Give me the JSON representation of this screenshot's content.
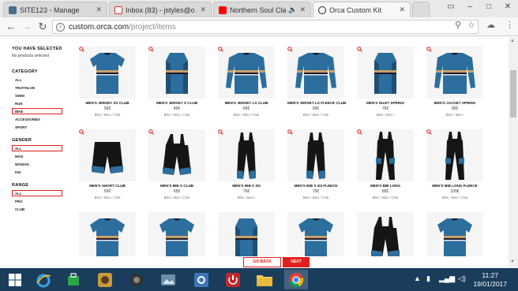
{
  "browser": {
    "tabs": [
      {
        "title": "SITE123 - Manage",
        "icon": "site123-icon",
        "color": "#4a6b8a"
      },
      {
        "title": "Inbox (83) - jstyles@o",
        "icon": "gmail-icon",
        "color": "#d93025"
      },
      {
        "title": "Northern Soul Clas",
        "icon": "youtube-icon",
        "color": "#ff0000"
      },
      {
        "title": "Orca Custom Kit",
        "icon": "orca-icon",
        "color": "#222222"
      }
    ],
    "url_host": "custom.orca.com",
    "url_path": "/project/items"
  },
  "sidebar": {
    "selected_heading": "YOU HAVE SELECTED",
    "selected_note": "No products selected",
    "category_heading": "CATEGORY",
    "categories": [
      "ALL",
      "TRIATHLON",
      "SWIM",
      "RUN",
      "BIKE",
      "ACCESSORIES",
      "SPORT"
    ],
    "category_selected": "BIKE",
    "gender_heading": "GENDER",
    "genders": [
      "ALL",
      "MAN",
      "WOMAN",
      "KID"
    ],
    "gender_selected": "ALL",
    "range_heading": "RANGE",
    "ranges": [
      "ALL",
      "PRO",
      "CLUB"
    ],
    "range_selected": "ALL"
  },
  "products": [
    {
      "name": "MEN'S JERSEY SS CLUB",
      "price": "50€",
      "category": "Bike / Man / Club",
      "kind": "jersey-ss"
    },
    {
      "name": "MEN'S JERSEY S CLUB",
      "price": "45€",
      "category": "Bike / Man / Club",
      "kind": "vest"
    },
    {
      "name": "MEN'S JERSEY LS CLUB",
      "price": "65€",
      "category": "Bike / Man / Club",
      "kind": "jersey-ls"
    },
    {
      "name": "MEN'S JERSEY LS FLEECE CLUB",
      "price": "69€",
      "category": "Bike / Man / Club",
      "kind": "jersey-ls"
    },
    {
      "name": "MEN'S GILET SPRING",
      "price": "75€",
      "category": "Bike / Man /",
      "kind": "vest"
    },
    {
      "name": "MEN'S JACKET SPRING",
      "price": "95€",
      "category": "Bike / Man /",
      "kind": "jersey-ls"
    },
    {
      "name": "MEN'S SHORT CLUB",
      "price": "50€",
      "category": "Bike / Man / Club",
      "kind": "shorts"
    },
    {
      "name": "MEN'S BIB S CLUB",
      "price": "65€",
      "category": "Bike / Man / Club",
      "kind": "bib-short"
    },
    {
      "name": "MEN'S BIB S 3/4",
      "price": "70€",
      "category": "Bike / Man /",
      "kind": "bib-34"
    },
    {
      "name": "MEN'S BIB S 3/4 FLEECE",
      "price": "75€",
      "category": "Bike / Man / Club",
      "kind": "bib-34"
    },
    {
      "name": "MEN'S BIB LONG",
      "price": "85€",
      "category": "Bike / Man / Club",
      "kind": "bib-long"
    },
    {
      "name": "MEN'S BIB LONG FLEECE",
      "price": "109€",
      "category": "Bike / Man / Club",
      "kind": "bib-long"
    },
    {
      "name": "",
      "price": "",
      "category": "",
      "kind": "jersey-ss"
    },
    {
      "name": "",
      "price": "",
      "category": "",
      "kind": "jersey-ss"
    },
    {
      "name": "",
      "price": "",
      "category": "",
      "kind": "vest"
    },
    {
      "name": "",
      "price": "",
      "category": "",
      "kind": "jersey-ss"
    },
    {
      "name": "",
      "price": "",
      "category": "",
      "kind": "bib-short"
    },
    {
      "name": "",
      "price": "",
      "category": "",
      "kind": "jersey-ss"
    }
  ],
  "footer": {
    "back_label": "GO BACK",
    "next_label": "NEXT"
  },
  "taskbar": {
    "time": "11:27",
    "date": "19/01/2017",
    "apps": [
      "start-icon",
      "ie-icon",
      "store-icon",
      "app-icon",
      "media-icon",
      "photos-icon",
      "settings-icon",
      "power-icon",
      "folder-icon",
      "chrome-icon"
    ]
  },
  "colors": {
    "accent": "#e02020",
    "jersey": "#2c6e9e",
    "taskbar": "#1a3d5c"
  }
}
